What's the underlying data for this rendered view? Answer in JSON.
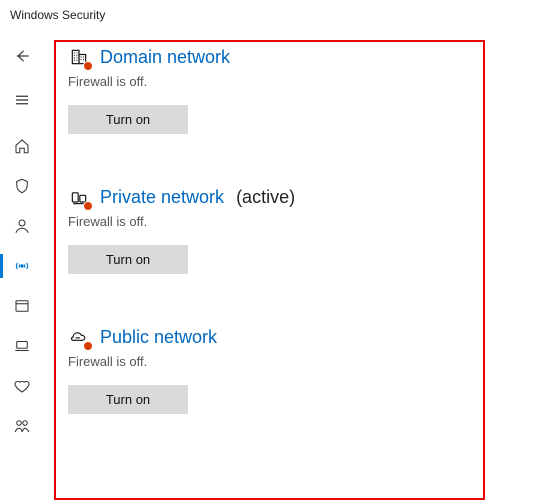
{
  "app_title": "Windows Security",
  "sidebar": {
    "back": "Back",
    "menu": "Menu",
    "items": [
      {
        "name": "home",
        "label": "Home"
      },
      {
        "name": "virus",
        "label": "Virus & threat protection"
      },
      {
        "name": "account",
        "label": "Account protection"
      },
      {
        "name": "firewall",
        "label": "Firewall & network protection",
        "active": true
      },
      {
        "name": "app",
        "label": "App & browser control"
      },
      {
        "name": "device",
        "label": "Device security"
      },
      {
        "name": "performance",
        "label": "Device performance & health"
      },
      {
        "name": "family",
        "label": "Family options"
      }
    ]
  },
  "networks": [
    {
      "id": "domain",
      "title": "Domain network",
      "status": "Firewall is off.",
      "button": "Turn on",
      "active_suffix": ""
    },
    {
      "id": "private",
      "title": "Private network",
      "status": "Firewall is off.",
      "button": "Turn on",
      "active_suffix": "(active)"
    },
    {
      "id": "public",
      "title": "Public network",
      "status": "Firewall is off.",
      "button": "Turn on",
      "active_suffix": ""
    }
  ]
}
